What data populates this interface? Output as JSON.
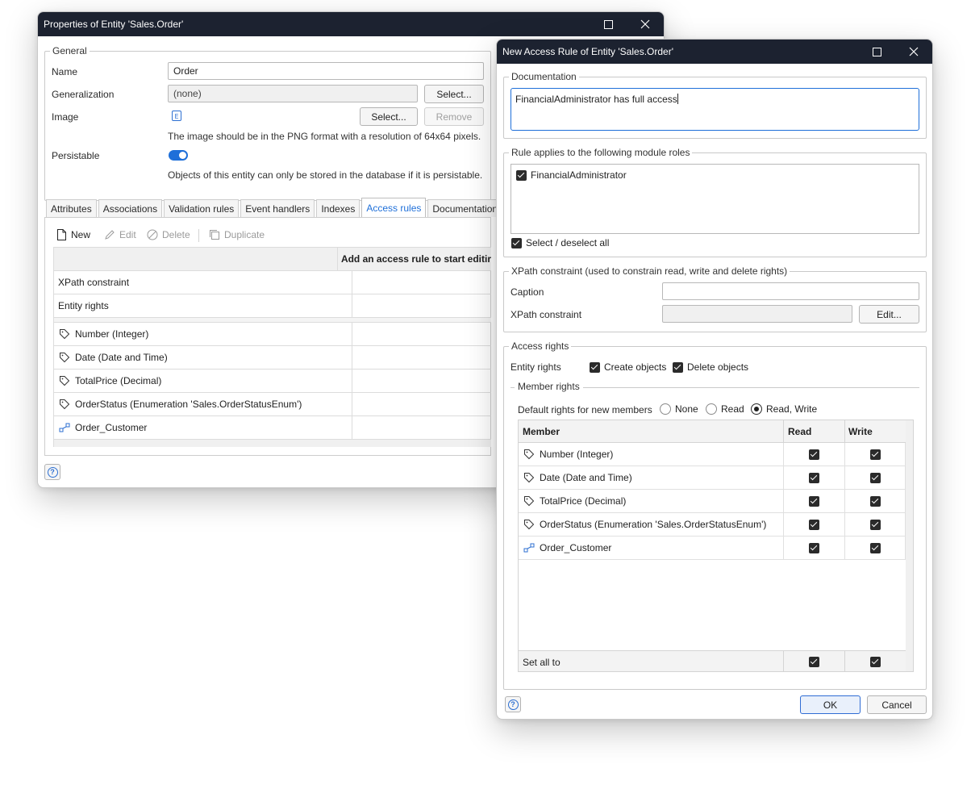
{
  "colors": {
    "titlebar": "#1c2230",
    "accent": "#1e6fd9",
    "selection_border": "#2f6cd4"
  },
  "props": {
    "title": "Properties of Entity 'Sales.Order'",
    "general": {
      "legend": "General",
      "name_label": "Name",
      "name_value": "Order",
      "generalization_label": "Generalization",
      "generalization_value": "(none)",
      "generalization_select": "Select...",
      "image_label": "Image",
      "image_select": "Select...",
      "image_remove": "Remove",
      "image_hint": "The image should be in the PNG format with a resolution of 64x64 pixels.",
      "persistable_label": "Persistable",
      "persistable_on": true,
      "persistable_hint": "Objects of this entity can only be stored in the database if it is persistable."
    },
    "tabs": [
      "Attributes",
      "Associations",
      "Validation rules",
      "Event handlers",
      "Indexes",
      "Access rules",
      "Documentation"
    ],
    "active_tab": "Access rules",
    "toolbar": {
      "new": "New",
      "edit": "Edit",
      "delete": "Delete",
      "duplicate": "Duplicate"
    },
    "grid": {
      "header": "Add an access rule to start editir",
      "rows": [
        "XPath constraint",
        "Entity rights"
      ],
      "members": [
        {
          "label": "Number (Integer)",
          "icon": "tag-icon"
        },
        {
          "label": "Date (Date and Time)",
          "icon": "tag-icon"
        },
        {
          "label": "TotalPrice (Decimal)",
          "icon": "tag-icon"
        },
        {
          "label": "OrderStatus (Enumeration 'Sales.OrderStatusEnum')",
          "icon": "tag-icon"
        },
        {
          "label": "Order_Customer",
          "icon": "association-icon"
        }
      ]
    }
  },
  "rule": {
    "title": "New Access Rule of Entity 'Sales.Order'",
    "documentation": {
      "legend": "Documentation",
      "text": "FinancialAdministrator has full access"
    },
    "roles": {
      "legend": "Rule applies to the following module roles",
      "items": [
        {
          "label": "FinancialAdministrator",
          "checked": true
        }
      ],
      "select_all": "Select / deselect all"
    },
    "xpath": {
      "legend": "XPath constraint (used to constrain read, write and delete rights)",
      "caption_label": "Caption",
      "caption_value": "",
      "constraint_label": "XPath constraint",
      "constraint_value": "",
      "edit_button": "Edit..."
    },
    "access": {
      "legend": "Access rights",
      "entity_rights_label": "Entity rights",
      "create_objects": "Create objects",
      "delete_objects": "Delete objects",
      "member_rights_legend": "Member rights",
      "default_rights_label": "Default rights for new members",
      "options": [
        "None",
        "Read",
        "Read, Write"
      ],
      "selected_option": "Read, Write",
      "table": {
        "col_member": "Member",
        "col_read": "Read",
        "col_write": "Write",
        "rows": [
          {
            "member": "Number (Integer)",
            "icon": "tag-icon",
            "read": true,
            "write": true
          },
          {
            "member": "Date (Date and Time)",
            "icon": "tag-icon",
            "read": true,
            "write": true
          },
          {
            "member": "TotalPrice (Decimal)",
            "icon": "tag-icon",
            "read": true,
            "write": true
          },
          {
            "member": "OrderStatus (Enumeration 'Sales.OrderStatusEnum')",
            "icon": "tag-icon",
            "read": true,
            "write": true
          },
          {
            "member": "Order_Customer",
            "icon": "association-icon",
            "read": true,
            "write": true
          }
        ],
        "set_all_label": "Set all to"
      }
    },
    "ok": "OK",
    "cancel": "Cancel"
  }
}
